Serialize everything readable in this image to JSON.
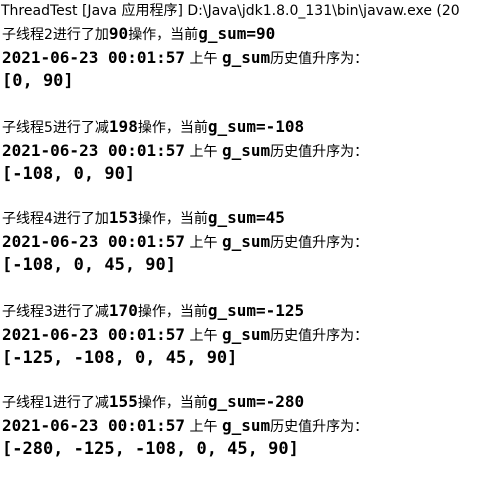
{
  "window": {
    "title": "ThreadTest [Java 应用程序] D:\\Java\\jdk1.8.0_131\\bin\\javaw.exe  (20"
  },
  "log": [
    {
      "op_prefix": "子线程2进行了加",
      "op_amount": "90",
      "op_suffix": "操作，当前",
      "op_sum": "g_sum=90",
      "ts_time": "2021-06-23 00:01:57",
      "ts_ampm": " 上午 ",
      "ts_var": "g_sum",
      "ts_label": "历史值升序为：",
      "array": "[0, 90]"
    },
    {
      "op_prefix": "子线程5进行了减",
      "op_amount": "198",
      "op_suffix": "操作，当前",
      "op_sum": "g_sum=-108",
      "ts_time": "2021-06-23 00:01:57",
      "ts_ampm": " 上午 ",
      "ts_var": "g_sum",
      "ts_label": "历史值升序为：",
      "array": "[-108, 0, 90]"
    },
    {
      "op_prefix": "子线程4进行了加",
      "op_amount": "153",
      "op_suffix": "操作，当前",
      "op_sum": "g_sum=45",
      "ts_time": "2021-06-23 00:01:57",
      "ts_ampm": " 上午 ",
      "ts_var": "g_sum",
      "ts_label": "历史值升序为：",
      "array": "[-108, 0, 45, 90]"
    },
    {
      "op_prefix": "子线程3进行了减",
      "op_amount": "170",
      "op_suffix": "操作，当前",
      "op_sum": "g_sum=-125",
      "ts_time": "2021-06-23 00:01:57",
      "ts_ampm": " 上午 ",
      "ts_var": "g_sum",
      "ts_label": "历史值升序为：",
      "array": "[-125, -108, 0, 45, 90]"
    },
    {
      "op_prefix": "子线程1进行了减",
      "op_amount": "155",
      "op_suffix": "操作，当前",
      "op_sum": "g_sum=-280",
      "ts_time": "2021-06-23 00:01:57",
      "ts_ampm": " 上午 ",
      "ts_var": "g_sum",
      "ts_label": "历史值升序为：",
      "array": "[-280, -125, -108, 0, 45, 90]"
    }
  ]
}
